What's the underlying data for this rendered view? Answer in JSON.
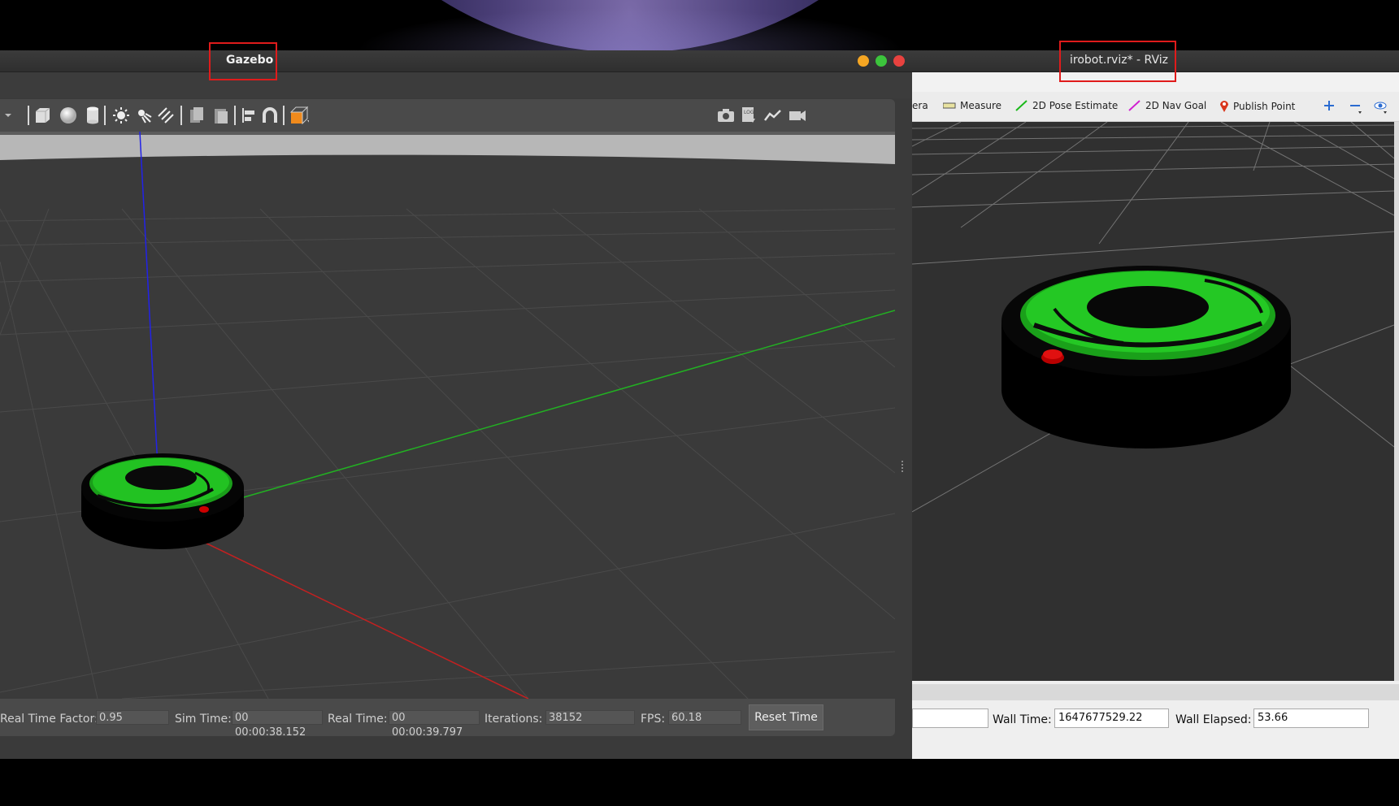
{
  "gazebo": {
    "title": "Gazebo",
    "status": {
      "real_time_factor_label": "Real Time Factor:",
      "real_time_factor": "0.95",
      "sim_time_label": "Sim Time:",
      "sim_time": "00 00:00:38.152",
      "real_time_label": "Real Time:",
      "real_time": "00 00:00:39.797",
      "iterations_label": "Iterations:",
      "iterations": "38152",
      "fps_label": "FPS:",
      "fps": "60.18",
      "reset_time_label": "Reset Time"
    },
    "toolbar_icons": [
      "dropdown-icon",
      "box-icon",
      "sphere-icon",
      "cylinder-icon",
      "point-light-icon",
      "spot-light-icon",
      "directional-light-icon",
      "copy-icon",
      "paste-icon",
      "align-icon",
      "snap-icon",
      "view-angle-icon",
      "screenshot-icon",
      "log-icon",
      "plot-icon",
      "record-icon"
    ]
  },
  "rviz": {
    "title": "irobot.rviz* - RViz",
    "tools": {
      "camera_partial": "era",
      "measure": "Measure",
      "pose_estimate": "2D Pose Estimate",
      "nav_goal": "2D Nav Goal",
      "publish_point": "Publish Point"
    },
    "time": {
      "wall_time_label": "Wall Time:",
      "wall_time": "1647677529.22",
      "wall_elapsed_label": "Wall Elapsed:",
      "wall_elapsed": "53.66",
      "partial_field": ""
    }
  },
  "colors": {
    "robot_green": "#18c81e",
    "highlight": "#e01b1b",
    "axis_x": "#c02020",
    "axis_y": "#1faa1f",
    "axis_z": "#2020e0"
  }
}
